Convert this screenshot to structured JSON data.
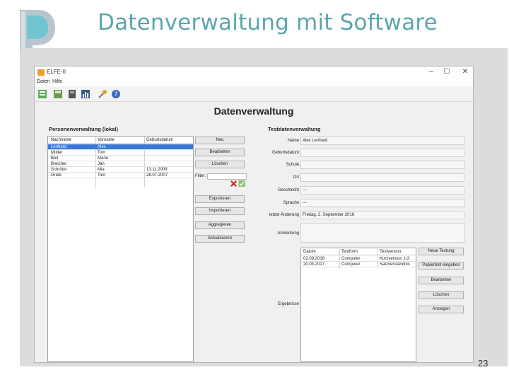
{
  "slide": {
    "title": "Datenverwaltung mit Software",
    "page_number": "23"
  },
  "window": {
    "title": "ELFE-II",
    "minimize": "–",
    "maximize": "☐",
    "close": "✕",
    "menu": [
      "Daten",
      "Hilfe"
    ],
    "toolbar_icons": [
      "users-icon",
      "save-icon",
      "calculator-icon",
      "chart-icon",
      "tools-icon",
      "help-icon"
    ]
  },
  "panel": {
    "heading": "Datenverwaltung",
    "persons": {
      "label": "Personenverwaltung (lokal)",
      "columns": [
        "Nachname",
        "Vorname",
        "Geburtsdatum"
      ],
      "rows": [
        [
          "Lenhard",
          "Alex",
          ""
        ],
        [
          "Müller",
          "Tom",
          ""
        ],
        [
          "Beil",
          "Marie",
          ""
        ],
        [
          "Breicher",
          "Jan",
          ""
        ],
        [
          "Schröter",
          "Mia",
          "13.11.2009"
        ],
        [
          "Grieb",
          "Tom",
          "28.07.2007"
        ]
      ],
      "selected_row": 0,
      "buttons": {
        "new": "Neu",
        "edit": "Bearbeiten",
        "delete": "Löschen",
        "export": "Exportieren",
        "import": "Importieren",
        "aggregate": "Aggregieren",
        "refresh": "Aktualisieren"
      },
      "filter_label": "Filter:"
    },
    "tests": {
      "label": "Testdatenverwaltung",
      "fields": [
        {
          "label": "Name",
          "value": "Alex Lenhard"
        },
        {
          "label": "Geburtsdatum",
          "value": ""
        },
        {
          "label": "Schule",
          "value": ""
        },
        {
          "label": "Ort",
          "value": ""
        },
        {
          "label": "Geschlecht",
          "value": "---"
        },
        {
          "label": "Sprache",
          "value": "---"
        },
        {
          "label": "letzte Änderung",
          "value": "Freitag, 2. September 2016"
        }
      ],
      "remarks_label": "Anmerkung",
      "results_label": "Ergebnisse",
      "results_columns": [
        "Datum",
        "Testform",
        "Testversion"
      ],
      "results_rows": [
        [
          "02.09.2016",
          "Computer",
          "Kurzversion 1-3"
        ],
        [
          "20.03.2017",
          "Computer",
          "Satzverständnis"
        ]
      ],
      "buttons": {
        "new_test": "Neue Testung",
        "paper_test": "Papiertest eingeben",
        "edit": "Bearbeiten",
        "delete": "Löschen",
        "show": "Anzeigen"
      }
    }
  }
}
